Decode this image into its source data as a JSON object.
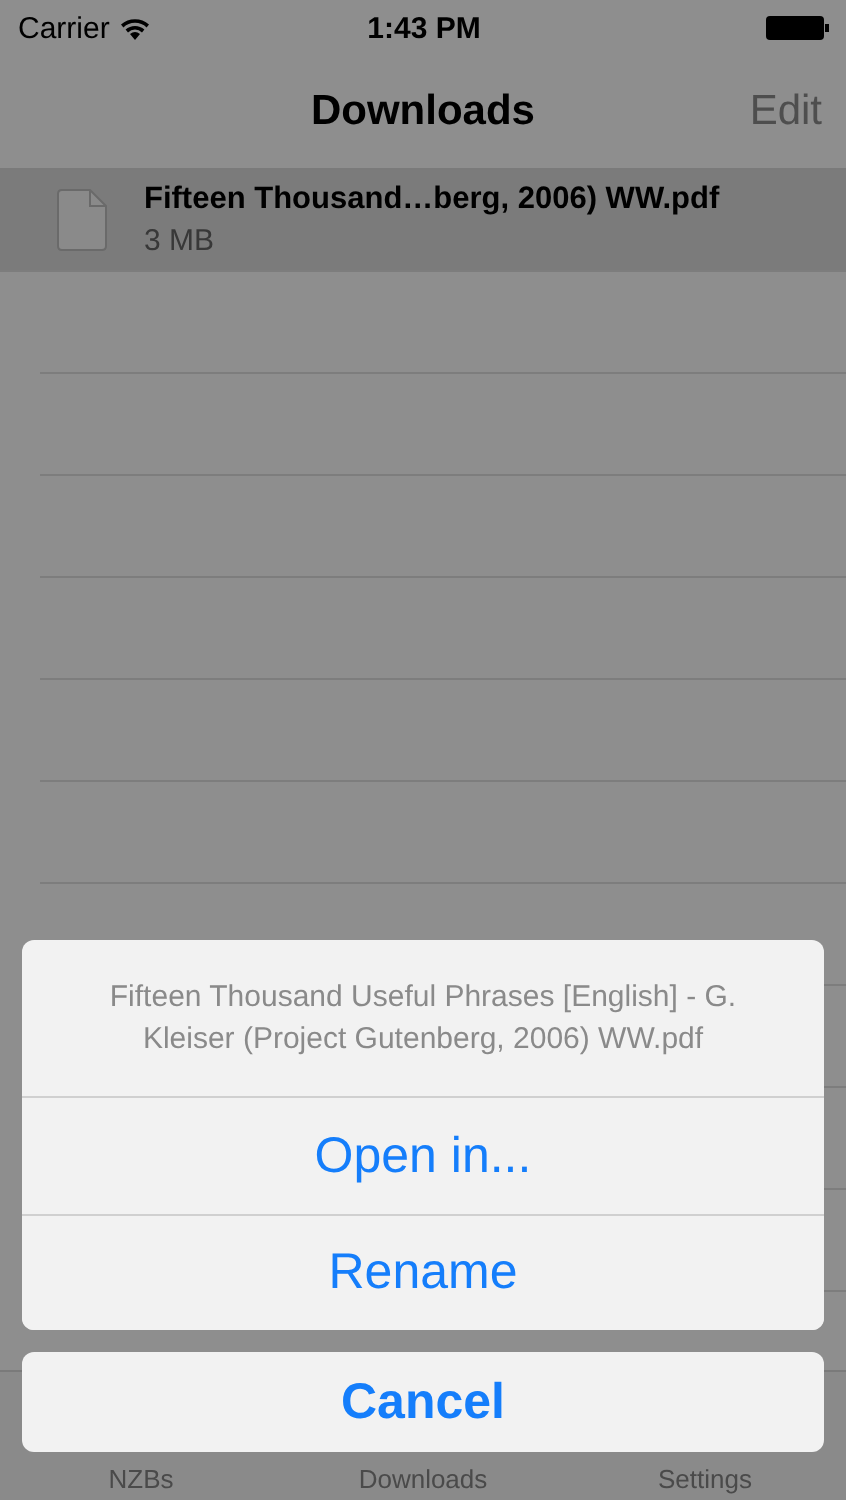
{
  "status_bar": {
    "carrier": "Carrier",
    "time": "1:43 PM"
  },
  "nav_bar": {
    "title": "Downloads",
    "edit": "Edit"
  },
  "files": [
    {
      "name": "Fifteen Thousand…berg, 2006) WW.pdf",
      "size": "3 MB",
      "selected": true
    }
  ],
  "action_sheet": {
    "title": "Fifteen Thousand Useful Phrases [English] - G. Kleiser (Project Gutenberg, 2006) WW.pdf",
    "actions": [
      {
        "label": "Open in..."
      },
      {
        "label": "Rename"
      }
    ],
    "cancel": "Cancel"
  },
  "tab_bar": {
    "items": [
      {
        "label": "NZBs"
      },
      {
        "label": "Downloads"
      },
      {
        "label": "Settings"
      }
    ]
  }
}
